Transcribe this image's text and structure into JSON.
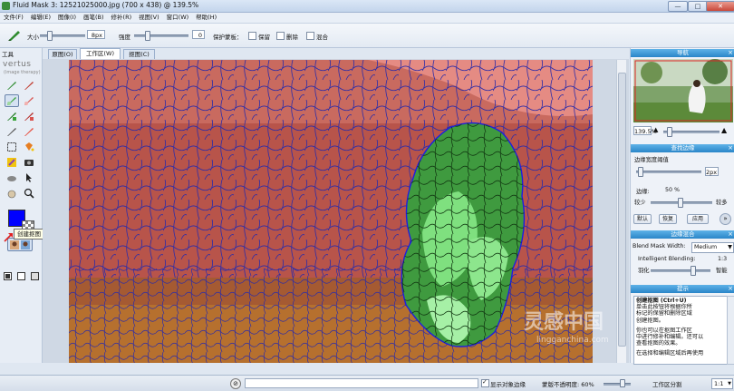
{
  "window": {
    "title": "Fluid Mask 3: 12521025000.jpg (700 x 438) @ 139.5%",
    "minimize": "—",
    "maximize": "□",
    "close": "✕"
  },
  "menu": [
    "文件(F)",
    "编辑(E)",
    "图像(I)",
    "画笔(B)",
    "修补(R)",
    "视图(V)",
    "窗口(W)",
    "帮助(H)"
  ],
  "toolbar": {
    "size_label": "大小",
    "size_value": "8px",
    "hardness_label": "强度",
    "hardness_value": "0",
    "protect_label": "保护蒙板：",
    "keep_label": "保留",
    "delete_label": "删除",
    "blend_label": "混合"
  },
  "tools": {
    "title": "工具",
    "brand_line1": "vertus",
    "brand_line2": "(image therapy)",
    "tooltip": "创建抠图 (Ctrl+U)",
    "primary_color": "#0000ff"
  },
  "tabs": [
    {
      "label": "原图(O)"
    },
    {
      "label": "工作区(W)"
    },
    {
      "label": "抠图(C)"
    }
  ],
  "right_panel": {
    "nav_title": "导航",
    "zoom_value": "139.5%",
    "edge_title": "查找边缘",
    "edge_width_label": "边缘宽度阈值",
    "edge_width_value": "2px",
    "edge_label": "边缘:",
    "edge_value": "50 %",
    "less_label": "较少",
    "more_label": "较多",
    "default_btn": "默认",
    "restore_btn": "恢复",
    "apply_btn": "应用",
    "blend_title": "边缘混合",
    "blend_width_label": "Blend Mask Width:",
    "blend_width_value": "Medium",
    "intelligent_label": "Intelligent Blending:",
    "intelligent_value": "1:3",
    "feather_label": "羽化",
    "smart_label": "智能",
    "tips_title": "提示",
    "tips_text": [
      "创建抠图 (Ctrl+U)",
      "单击此按钮将根据你所",
      "标记的保留和删除区域",
      "创建抠图。",
      "",
      "你也可以在抠图工作区",
      "中进行修补和编辑。还可以",
      "查看抠图的效果。",
      "",
      "在选择和编辑区域后再使用"
    ]
  },
  "status": {
    "show_edges_label": "显示对象边缘",
    "opacity_label": "蒙版不透明度: 60%",
    "workspace_label": "工作区分割",
    "ratio_value": "1:1"
  },
  "watermark": {
    "main": "灵感中国",
    "sub": "lingganchina.com"
  }
}
